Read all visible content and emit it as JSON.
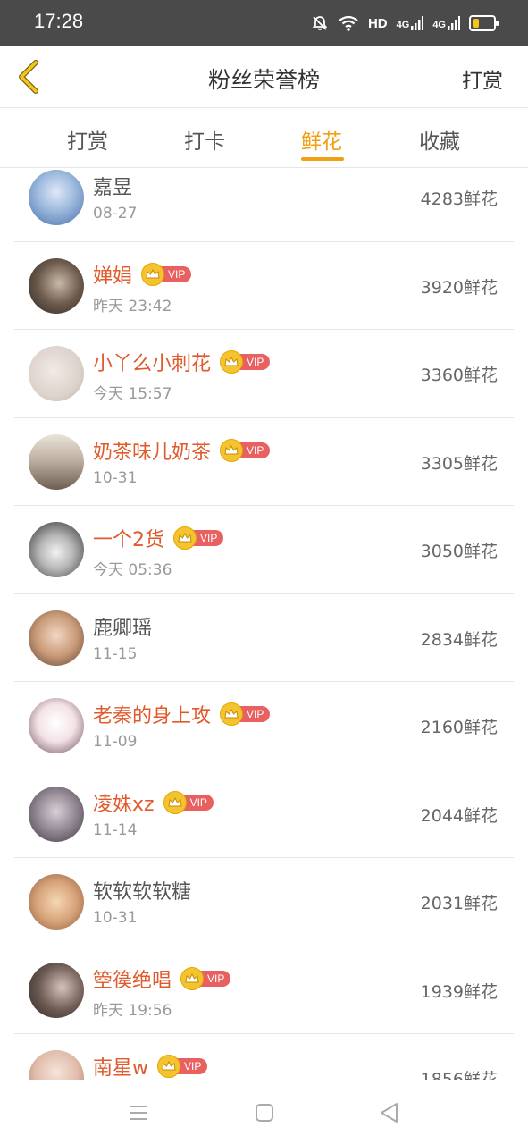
{
  "status_bar": {
    "time": "17:28",
    "hd": "HD",
    "net1": "4G",
    "net2": "4G"
  },
  "header": {
    "title": "粉丝荣誉榜",
    "action": "打赏",
    "back_icon": "chevron-left-icon"
  },
  "tabs": [
    {
      "label": "打赏",
      "active": false
    },
    {
      "label": "打卡",
      "active": false
    },
    {
      "label": "鲜花",
      "active": true
    },
    {
      "label": "收藏",
      "active": false
    }
  ],
  "vip_label": "VIP",
  "rows": [
    {
      "name": "嘉昱",
      "time": "08-27",
      "amount": "4283鲜花",
      "vip": false
    },
    {
      "name": "婵娟",
      "time": "昨天 23:42",
      "amount": "3920鲜花",
      "vip": true
    },
    {
      "name": "小丫么小刺花",
      "time": "今天 15:57",
      "amount": "3360鲜花",
      "vip": true
    },
    {
      "name": "奶茶味儿奶茶",
      "time": "10-31",
      "amount": "3305鲜花",
      "vip": true
    },
    {
      "name": "一个2货",
      "time": "今天 05:36",
      "amount": "3050鲜花",
      "vip": true
    },
    {
      "name": "鹿卿瑶",
      "time": "11-15",
      "amount": "2834鲜花",
      "vip": false
    },
    {
      "name": "老秦的身上攻",
      "time": "11-09",
      "amount": "2160鲜花",
      "vip": true
    },
    {
      "name": "凌姝xz",
      "time": "11-14",
      "amount": "2044鲜花",
      "vip": true
    },
    {
      "name": "软软软软糖",
      "time": "10-31",
      "amount": "2031鲜花",
      "vip": false
    },
    {
      "name": "箜篌绝唱",
      "time": "昨天 19:56",
      "amount": "1939鲜花",
      "vip": true
    },
    {
      "name": "南星w",
      "time": "",
      "amount": "1856鲜花",
      "vip": true
    }
  ],
  "colors": {
    "accent": "#f0a012",
    "vip_name": "#e05a2c",
    "vip_badge": "#e86060",
    "status_bar": "#4a4a4a"
  }
}
